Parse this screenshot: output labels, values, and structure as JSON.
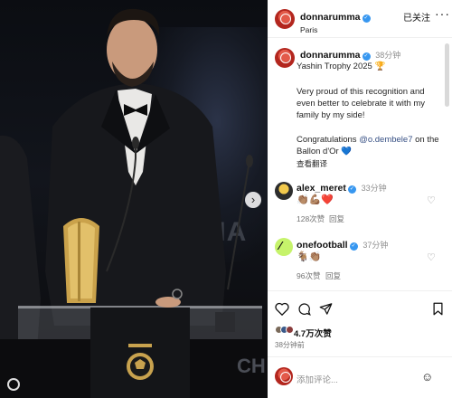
{
  "post": {
    "username": "donnarumma",
    "location": "Paris",
    "follow_label": "已关注",
    "more_label": "···"
  },
  "caption": {
    "username": "donnarumma",
    "time": "38分钟",
    "title": "Yashin Trophy 2025",
    "trophy_emoji": "🏆",
    "body": "Very proud of this recognition and even better to celebrate it with my family by my side!",
    "congrats_prefix": "Congratulations ",
    "mention": "@o.dembele7",
    "congrats_suffix": " on the Ballon d'Or ",
    "heart_emoji": "💙",
    "translate": "查看翻译"
  },
  "comments": [
    {
      "username": "alex_meret",
      "time": "33分钟",
      "text": "👏🏽💪🏽❤️",
      "likes": "128次赞",
      "reply": "回复"
    },
    {
      "username": "onefootball",
      "time": "37分钟",
      "text": "🐐👏🏽",
      "likes": "96次赞",
      "reply": "回复"
    }
  ],
  "actions": {
    "like_icon": "heart-outline-icon",
    "comment_icon": "comment-icon",
    "share_icon": "send-icon",
    "save_icon": "bookmark-icon"
  },
  "stats": {
    "likes": "4.7万次赞",
    "time_ago": "38分钟前"
  },
  "comment_box": {
    "placeholder": "添加评论..."
  },
  "photo": {
    "stage_text": "HA",
    "podium_text": "CH"
  },
  "colors": {
    "verified": "#3797f0",
    "mention": "#385185",
    "avatar_red": "#b3261e"
  }
}
